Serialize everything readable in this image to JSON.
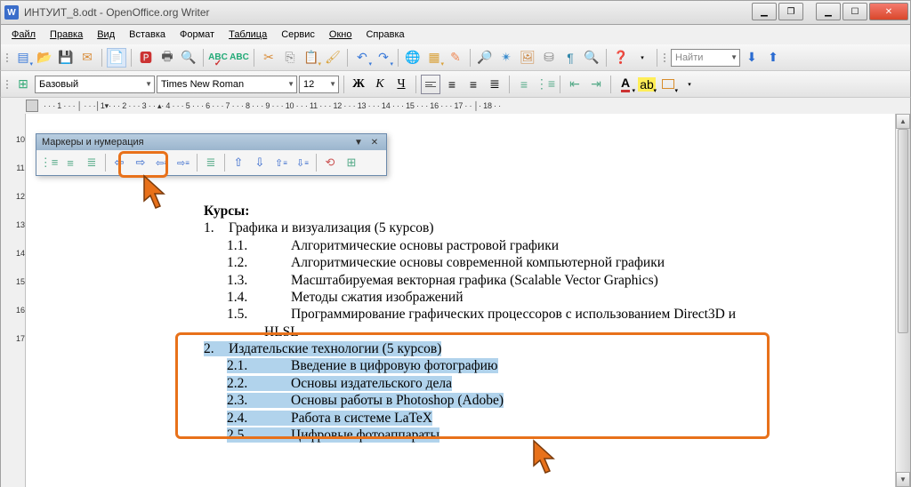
{
  "window": {
    "title": "ИНТУИТ_8.odt - OpenOffice.org Writer",
    "app_icon": "W"
  },
  "menu": [
    "Файл",
    "Правка",
    "Вид",
    "Вставка",
    "Формат",
    "Таблица",
    "Сервис",
    "Окно",
    "Справка"
  ],
  "toolbar1": {
    "find_placeholder": "Найти"
  },
  "format": {
    "style": "Базовый",
    "font": "Times New Roman",
    "size": "12",
    "bold": "Ж",
    "italic": "К",
    "underline": "Ч"
  },
  "ruler_h": " · · · 1 · · · │ · · ·│1▾· · · 2 · · · 3 · · ▴· 4 · · · 5 · · · 6 · · · 7 · · · 8 · · · 9 · · · 10 · · · 11 · · · 12 · · · 13 · · · 14 · · · 15 · · · 16 · · · 17 · · │· 18 · ·",
  "ruler_v": [
    "",
    "",
    "10",
    "11",
    "12",
    "13",
    "14",
    "15",
    "16",
    "17"
  ],
  "float_toolbar": {
    "title": "Маркеры и нумерация"
  },
  "doc": {
    "heading": "Курсы:",
    "s1": {
      "num": "1.",
      "text": "Графика и визуализация (5 курсов)"
    },
    "s1_1": {
      "num": "1.1.",
      "text": "Алгоритмические основы растровой графики"
    },
    "s1_2": {
      "num": "1.2.",
      "text": "Алгоритмические основы современной компьютерной графики"
    },
    "s1_3": {
      "num": "1.3.",
      "text": "Масштабируемая векторная графика (Scalable Vector Graphics)"
    },
    "s1_4": {
      "num": "1.4.",
      "text": "Методы сжатия изображений"
    },
    "s1_5": {
      "num": "1.5.",
      "text": "Программирование графических процессоров с использованием Direct3D и"
    },
    "s1_5b": "HLSL",
    "s2": {
      "num": "2.",
      "text": "Издательские технологии (5 курсов)"
    },
    "s2_1": {
      "num": "2.1.",
      "text": "Введение в цифровую фотографию"
    },
    "s2_2": {
      "num": "2.2.",
      "text": "Основы издательского дела"
    },
    "s2_3": {
      "num": "2.3.",
      "text": "Основы работы в Photoshop (Adobe)"
    },
    "s2_4": {
      "num": "2.4.",
      "text": "Работа в системе LaTeX"
    },
    "s2_5": {
      "num": "2.5.",
      "text": "Цифровые фотоаппараты"
    }
  }
}
